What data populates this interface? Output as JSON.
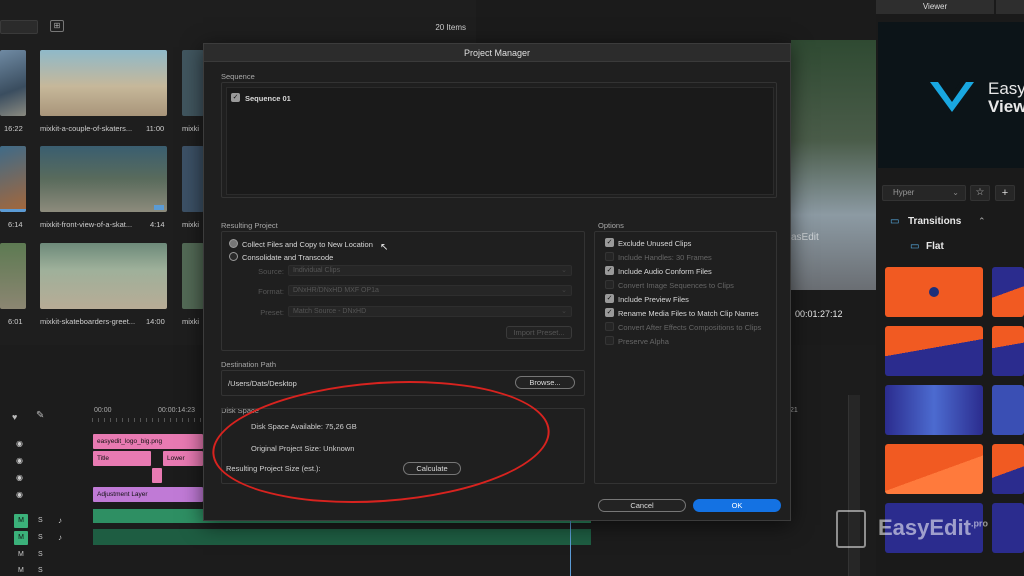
{
  "bin": {
    "items_count": "20 Items",
    "thumbs": [
      {
        "label": "",
        "duration": "16:22"
      },
      {
        "label": "mixkit-a-couple-of-skaters...",
        "duration": "11:00"
      },
      {
        "label": "mixki",
        "duration": ""
      },
      {
        "label": "",
        "duration": "6:14"
      },
      {
        "label": "mixkit-front-view-of-a-skat...",
        "duration": "4:14"
      },
      {
        "label": "mixki",
        "duration": ""
      },
      {
        "label": "",
        "duration": "6:01"
      },
      {
        "label": "mixkit-skateboarders-greet...",
        "duration": "14:00"
      },
      {
        "label": "mixki",
        "duration": ""
      }
    ]
  },
  "program_monitor": {
    "timecode": "00:01:27:12",
    "watermark": "asEdit"
  },
  "timeline": {
    "ruler": [
      "00:00",
      "00:00:14:23",
      "21"
    ],
    "clips": {
      "logo": "easyedit_logo_big.png",
      "title": "Title",
      "lower": "Lower",
      "adjustment": "Adjustment Layer"
    },
    "track_labels": {
      "m": "M",
      "s": "S"
    }
  },
  "right_panel": {
    "viewer_tab": "Viewer",
    "brand_name": "Easy",
    "brand_name2": "View",
    "dropdown": "Hyper",
    "section": "Transitions",
    "subsection": "Flat",
    "watermark": "EasyEdit",
    "watermark_sup": ".pro"
  },
  "dialog": {
    "title": "Project Manager",
    "sequence_label": "Sequence",
    "sequence_item": "Sequence 01",
    "resulting_project_label": "Resulting Project",
    "radio_collect": "Collect Files and Copy to New Location",
    "radio_consolidate": "Consolidate and Transcode",
    "source_label": "Source:",
    "source_value": "Individual Clips",
    "format_label": "Format:",
    "format_value": "DNxHR/DNxHD MXF OP1a",
    "preset_label": "Preset:",
    "preset_value": "Match Source - DNxHD",
    "import_preset": "Import Preset...",
    "options_label": "Options",
    "options": [
      {
        "label": "Exclude Unused Clips",
        "checked": true,
        "enabled": true
      },
      {
        "label": "Include Handles:   30 Frames",
        "checked": false,
        "enabled": false
      },
      {
        "label": "Include Audio Conform Files",
        "checked": true,
        "enabled": true
      },
      {
        "label": "Convert Image Sequences to Clips",
        "checked": false,
        "enabled": false
      },
      {
        "label": "Include Preview Files",
        "checked": true,
        "enabled": true
      },
      {
        "label": "Rename Media Files to Match Clip Names",
        "checked": true,
        "enabled": true
      },
      {
        "label": "Convert After Effects Compositions to Clips",
        "checked": false,
        "enabled": false
      },
      {
        "label": "Preserve Alpha",
        "checked": false,
        "enabled": false
      }
    ],
    "destination_label": "Destination Path",
    "destination_value": "/Users/Dats/Desktop",
    "browse": "Browse...",
    "disk_space_label": "Disk Space",
    "disk_available": "Disk Space Available:  75,26 GB",
    "original_size": "Original Project Size:  Unknown",
    "resulting_size": "Resulting Project Size (est.):",
    "calculate": "Calculate",
    "cancel": "Cancel",
    "ok": "OK"
  },
  "colors": {
    "accent_blue": "#1472e3",
    "annotation_red": "#d8231f",
    "clip_pink": "#e87ab2",
    "clip_purple": "#c07ad6",
    "clip_green": "#3bb17a",
    "tile_orange": "#f15a22"
  }
}
